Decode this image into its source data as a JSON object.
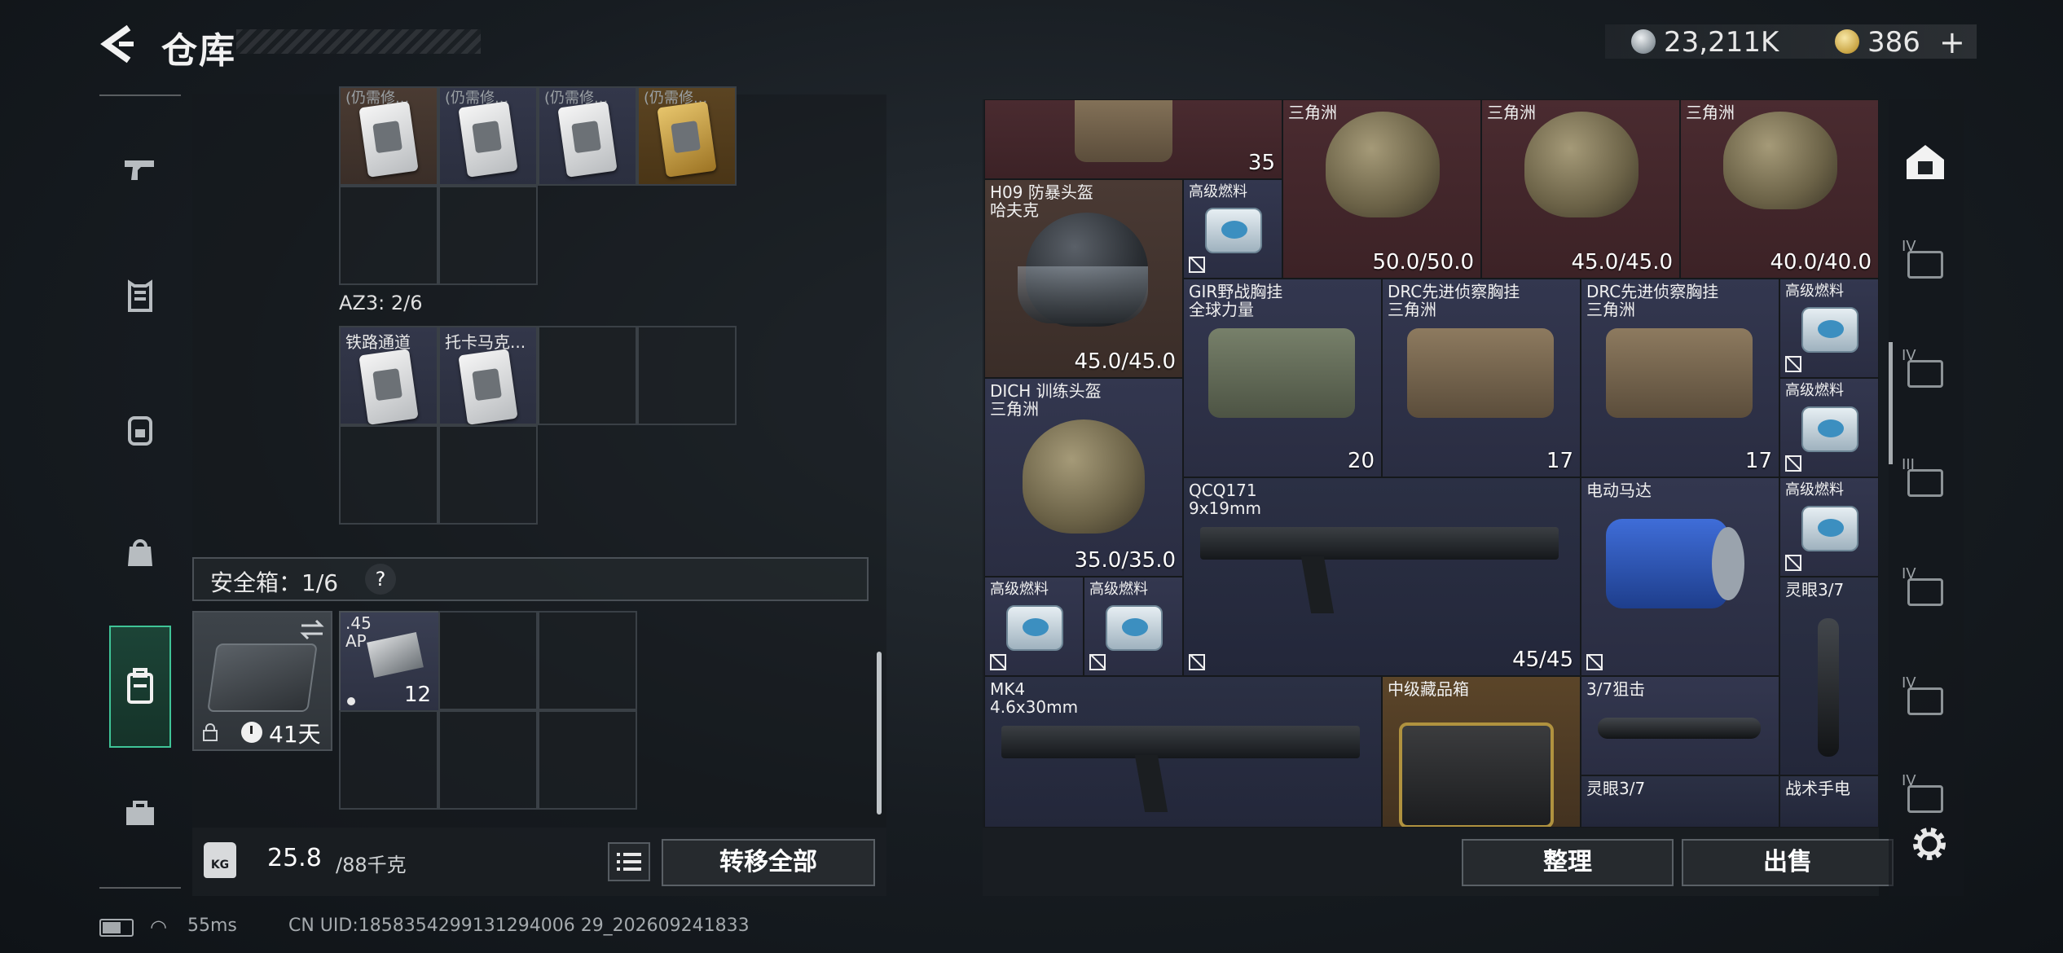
{
  "header": {
    "title": "仓库",
    "money": "23,211K",
    "tokens": "386",
    "add": "+"
  },
  "left_rail": [
    "pistol-icon",
    "vest-icon",
    "backpack-icon",
    "bag-icon",
    "safe-case-icon",
    "toolbox-icon"
  ],
  "container": {
    "top_items": [
      "(仍需修...",
      "(仍需修...",
      "(仍需修...",
      "(仍需修..."
    ],
    "az3_label": "AZ3: 2/6",
    "az3_items": [
      "铁路通道",
      "托卡马克..."
    ]
  },
  "safe": {
    "label": "安全箱：1/6",
    "help": "?",
    "days": "41天",
    "ammo_name_line1": ".45",
    "ammo_name_line2": "AP",
    "ammo_count": "12"
  },
  "footer_left": {
    "weight_current": "25.8",
    "weight_max": "/88千克",
    "transfer_label": "转移全部",
    "kg": "KG"
  },
  "status": {
    "ping": "55ms",
    "uid": "CN UID:1858354299131294006 29_202609241833"
  },
  "stash": {
    "vest_count": "35",
    "helmet1": {
      "maker": "三角洲",
      "dur": "50.0/50.0"
    },
    "helmet2": {
      "maker": "三角洲",
      "dur": "45.0/45.0"
    },
    "helmet3": {
      "maker": "三角洲",
      "dur": "40.0/40.0"
    },
    "h09": {
      "name": "H09 防暴头盔",
      "maker": "哈夫克",
      "dur": "45.0/45.0"
    },
    "fuel": "高级燃料",
    "gir": {
      "name": "GIR野战胸挂",
      "maker": "全球力量",
      "cap": "20"
    },
    "drc1": {
      "name": "DRC先进侦察胸挂",
      "maker": "三角洲",
      "cap": "17"
    },
    "drc2": {
      "name": "DRC先进侦察胸挂",
      "maker": "三角洲",
      "cap": "17"
    },
    "dich": {
      "name": "DICH 训练头盔",
      "maker": "三角洲",
      "dur": "35.0/35.0"
    },
    "qcq": {
      "name": "QCQ171",
      "caliber": "9x19mm",
      "ammo": "45/45"
    },
    "motor": "电动马达",
    "scope_a": "灵眼3/7",
    "mk4": {
      "name": "MK4",
      "caliber": "4.6x30mm"
    },
    "crate": "中级藏品箱",
    "sniper_scope": "3/7狙击",
    "scope_b": "灵眼3/7",
    "flashlight": "战术手电"
  },
  "footer_right": {
    "sort_label": "整理",
    "sell_label": "出售"
  },
  "right_rail": {
    "tiers": [
      "IV",
      "IV",
      "III",
      "IV",
      "IV",
      "IV"
    ]
  },
  "colors": {
    "accent_green": "#3fc497",
    "purple_cell": "#33374f",
    "red_cell": "#4a2b30",
    "gold_cell": "#5b4529"
  }
}
